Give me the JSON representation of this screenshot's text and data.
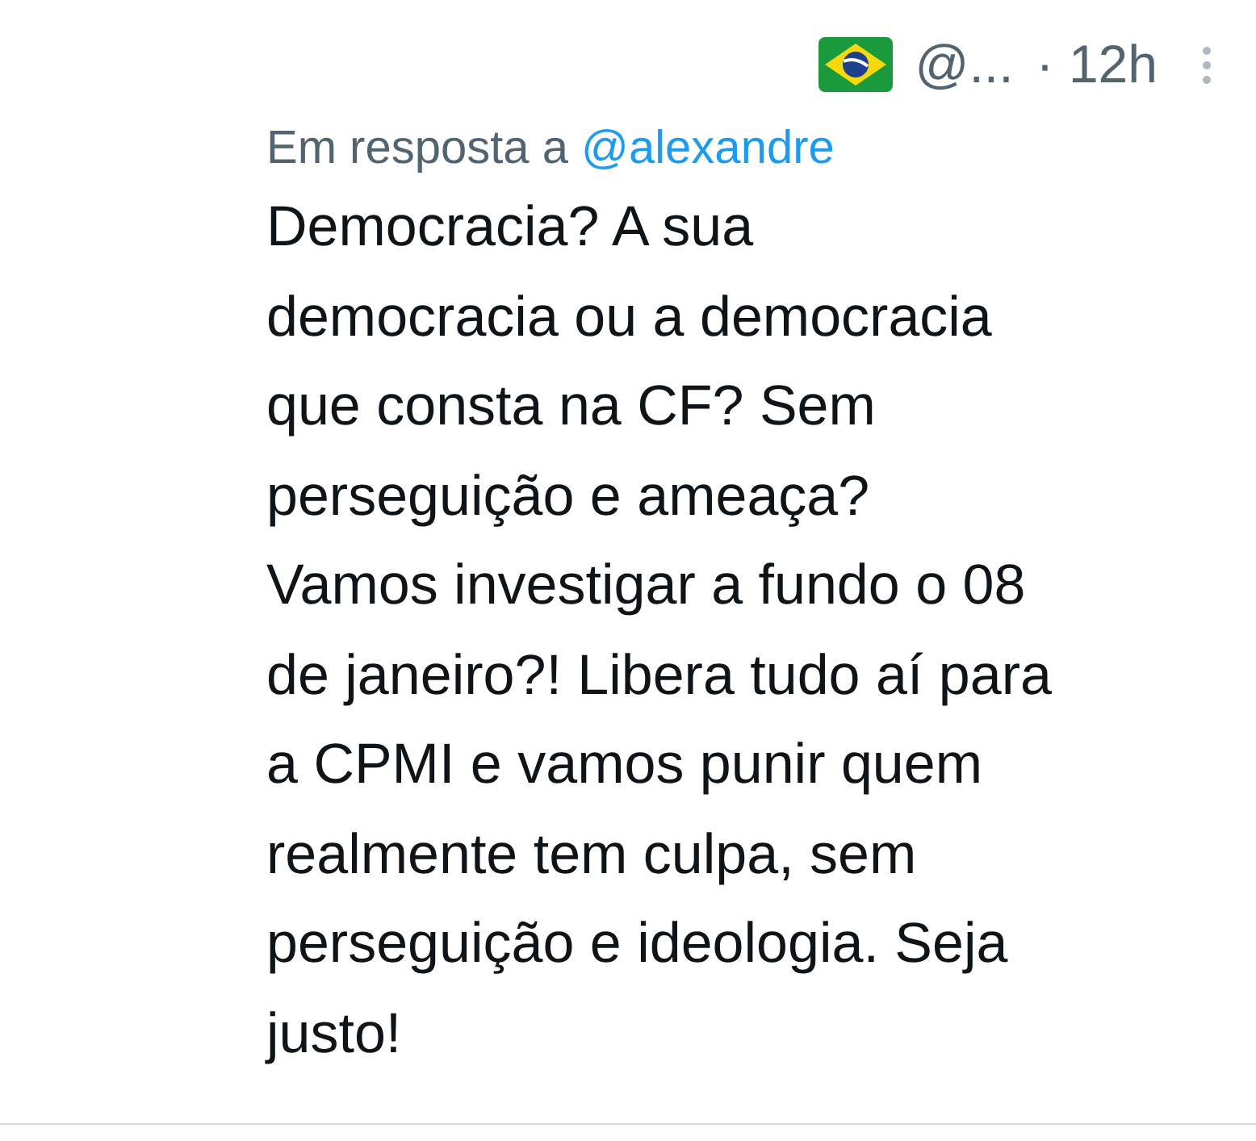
{
  "header": {
    "handle": "@...",
    "time": "· 12h"
  },
  "reply_to": {
    "label": "Em resposta a",
    "handle": "@alexandre"
  },
  "body_lines": [
    "Democracia? A sua",
    "democracia ou a democracia",
    "que consta na CF? Sem",
    "perseguição e ameaça?",
    "Vamos investigar a fundo o 08",
    "de janeiro?! Libera tudo aí para",
    "a CPMI e vamos punir quem",
    "realmente tem culpa, sem",
    "perseguição e ideologia. Seja",
    "justo!"
  ]
}
